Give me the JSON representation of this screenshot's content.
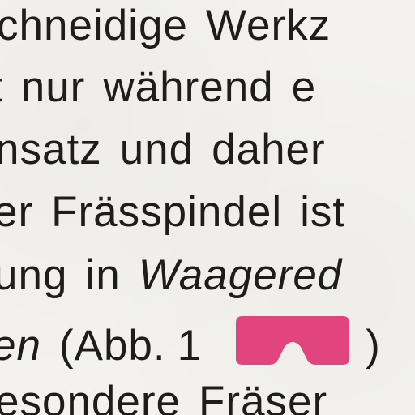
{
  "lines": [
    {
      "words": [
        "chneidige",
        "Werkz"
      ]
    },
    {
      "words": [
        "t",
        "nur",
        "während",
        "e"
      ]
    },
    {
      "words": [
        "nsatz",
        "und",
        "daher"
      ]
    },
    {
      "words": [
        "er",
        "Frässpindel",
        "ist"
      ]
    },
    {
      "words": [
        "ung",
        "in"
      ],
      "italic_word": "Waagered"
    },
    {
      "italic_start": "en",
      "paren_text": "(Abb.",
      "number": "1",
      "tail": ")"
    },
    {
      "words": [
        "esondere",
        "Fräser"
      ]
    }
  ],
  "marker": {
    "icon": "glasses-icon",
    "color": "#e2457e"
  }
}
